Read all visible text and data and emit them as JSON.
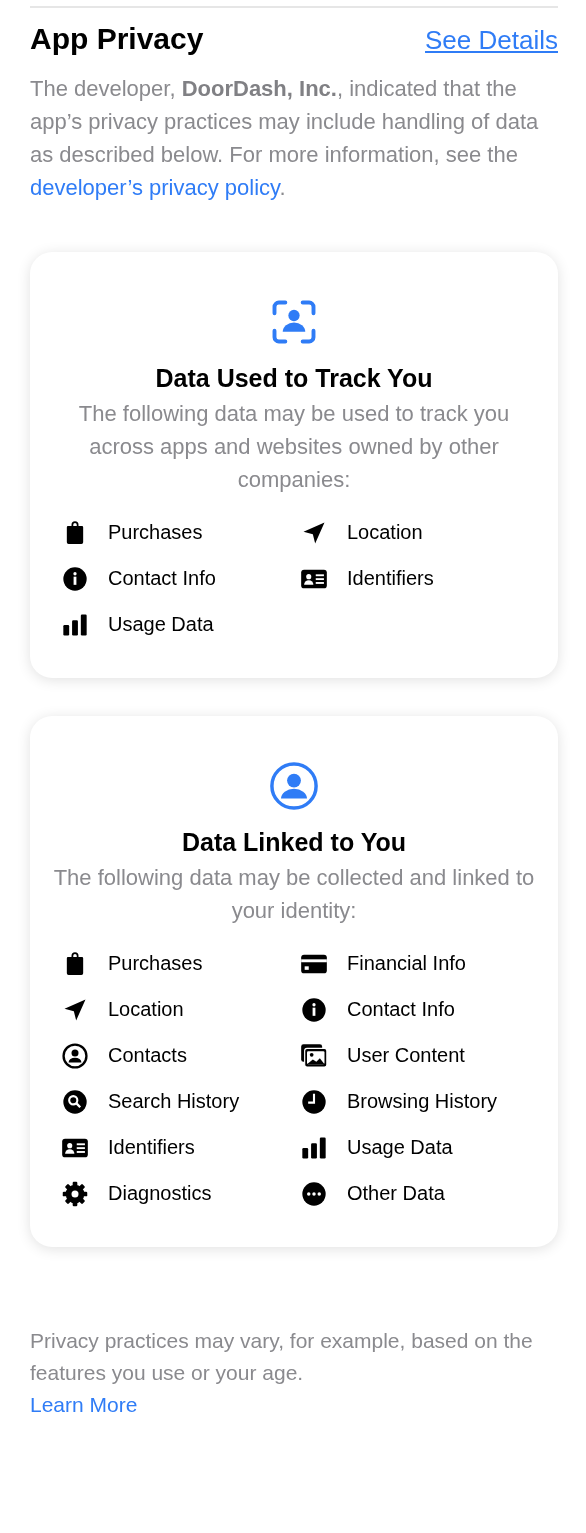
{
  "header": {
    "title": "App Privacy",
    "action": "See Details"
  },
  "description": {
    "text": "The developer, **DoorDash, Inc.**, indicated that the app’s privacy practices may include handling of data as described below. For more information, see the ",
    "link": "developer’s privacy policy",
    "end": "."
  },
  "cards": [
    {
      "kind": "track",
      "title": "Data Used to Track You",
      "subtitle": "The following data may be used to track you across apps and websites owned by other companies:",
      "columns": [
        [
          {
            "kind": "bag",
            "label": "Purchases"
          },
          {
            "kind": "info",
            "label": "Contact Info"
          },
          {
            "kind": "bars",
            "label": "Usage Data"
          }
        ],
        [
          {
            "kind": "arrow",
            "label": "Location"
          },
          {
            "kind": "idcard",
            "label": "Identifiers"
          }
        ]
      ]
    },
    {
      "kind": "linked",
      "title": "Data Linked to You",
      "subtitle": "The following data may be collected and linked to your identity:",
      "columns": [
        [
          {
            "kind": "bag",
            "label": "Purchases"
          },
          {
            "kind": "arrow",
            "label": "Location"
          },
          {
            "kind": "person",
            "label": "Contacts"
          },
          {
            "kind": "search",
            "label": "Search History"
          },
          {
            "kind": "idcard",
            "label": "Identifiers"
          },
          {
            "kind": "gear",
            "label": "Diagnostics"
          }
        ],
        [
          {
            "kind": "card",
            "label": "Financial Info"
          },
          {
            "kind": "info",
            "label": "Contact Info"
          },
          {
            "kind": "photos",
            "label": "User Content"
          },
          {
            "kind": "clock",
            "label": "Browsing History"
          },
          {
            "kind": "bars",
            "label": "Usage Data"
          },
          {
            "kind": "dots",
            "label": "Other Data"
          }
        ]
      ]
    }
  ],
  "footer": {
    "text": "Privacy practices may vary, for example, based on the features you use or your age.",
    "link": "Learn More"
  }
}
